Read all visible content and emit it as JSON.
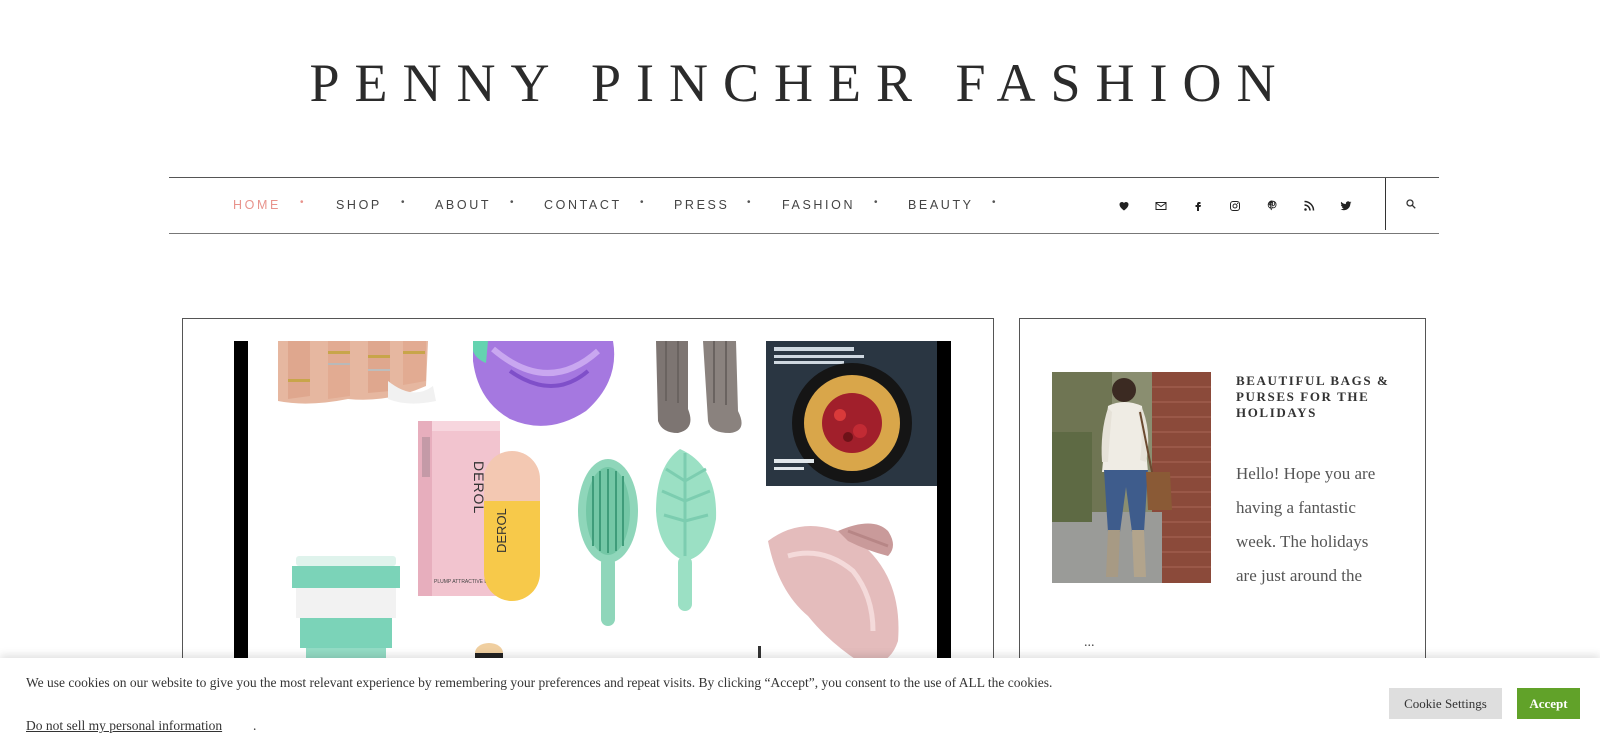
{
  "site": {
    "title": "PENNY PINCHER FASHION"
  },
  "nav": {
    "items": [
      {
        "label": "HOME",
        "active": true
      },
      {
        "label": "SHOP",
        "active": false
      },
      {
        "label": "ABOUT",
        "active": false
      },
      {
        "label": "CONTACT",
        "active": false
      },
      {
        "label": "PRESS",
        "active": false
      },
      {
        "label": "FASHION",
        "active": false
      },
      {
        "label": "BEAUTY",
        "active": false
      }
    ],
    "separator": "•",
    "social_icons": [
      "heart-icon",
      "email-icon",
      "facebook-icon",
      "instagram-icon",
      "pinterest-icon",
      "rss-icon",
      "twitter-icon"
    ],
    "search_icon": "search-icon",
    "active_color": "#e8938c"
  },
  "featured_post": {
    "image_name": "holiday-gift-collage",
    "collage_labels": {
      "box_brand": "DEROL",
      "box_caption": "PLUMP ATTRACTIVE LIP",
      "bottle_brand": "DEROL"
    }
  },
  "sidebar": {
    "post_title": "BEAUTIFUL BAGS & PURSES FOR THE HOLIDAYS",
    "excerpt": "Hello! Hope you are having a fantastic week. The holidays are just around the",
    "ellipsis": "..."
  },
  "cookie": {
    "text": "We use cookies on our website to give you the most relevant experience by remembering your preferences and repeat visits. By clicking “Accept”, you consent to the use of ALL the cookies.",
    "link": "Do not sell my personal information",
    "link_suffix": ".",
    "settings_label": "Cookie Settings",
    "accept_label": "Accept",
    "accept_color": "#61a229"
  }
}
